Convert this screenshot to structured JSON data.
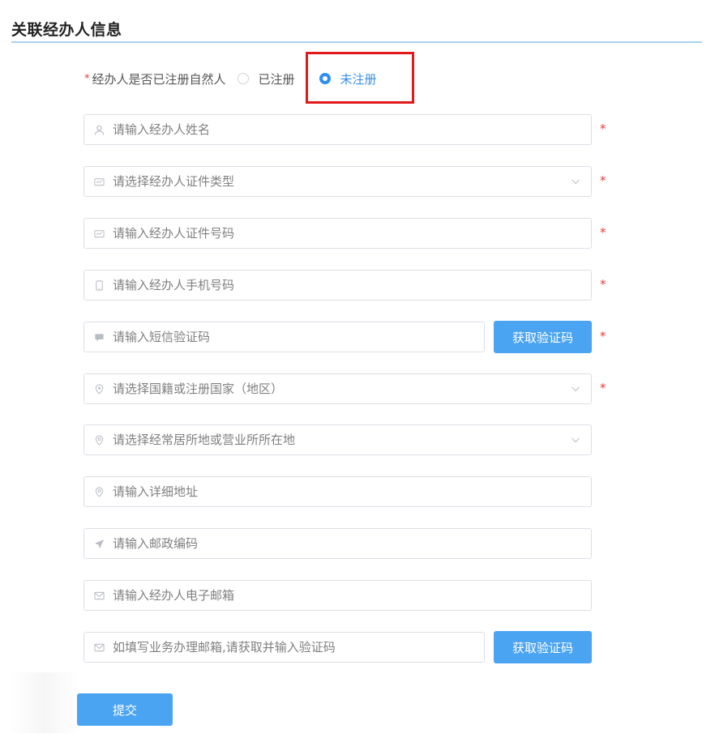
{
  "section": {
    "title": "关联经办人信息"
  },
  "registered_question": {
    "required_mark": "*",
    "label": "经办人是否已注册自然人",
    "options": [
      {
        "label": "已注册",
        "checked": false
      },
      {
        "label": "未注册",
        "checked": true
      }
    ]
  },
  "form": {
    "required_mark": "*",
    "name_placeholder": "请输入经办人姓名",
    "id_type_placeholder": "请选择经办人证件类型",
    "id_number_placeholder": "请输入经办人证件号码",
    "phone_placeholder": "请输入经办人手机号码",
    "sms_code_placeholder": "请输入短信验证码",
    "sms_code_button": "获取验证码",
    "nationality_placeholder": "请选择国籍或注册国家（地区）",
    "residence_placeholder": "请选择经常居所地或营业所所在地",
    "address_placeholder": "请输入详细地址",
    "postcode_placeholder": "请输入邮政编码",
    "email_placeholder": "请输入经办人电子邮箱",
    "business_email_placeholder": "如填写业务办理邮箱,请获取并输入验证码",
    "email_code_button": "获取验证码",
    "submit_button": "提交"
  },
  "colors": {
    "accent": "#2f8ff0",
    "button": "#4ba4f2",
    "required": "#e24040",
    "highlight": "#e1191b",
    "section_line": "#a9d3ee"
  }
}
